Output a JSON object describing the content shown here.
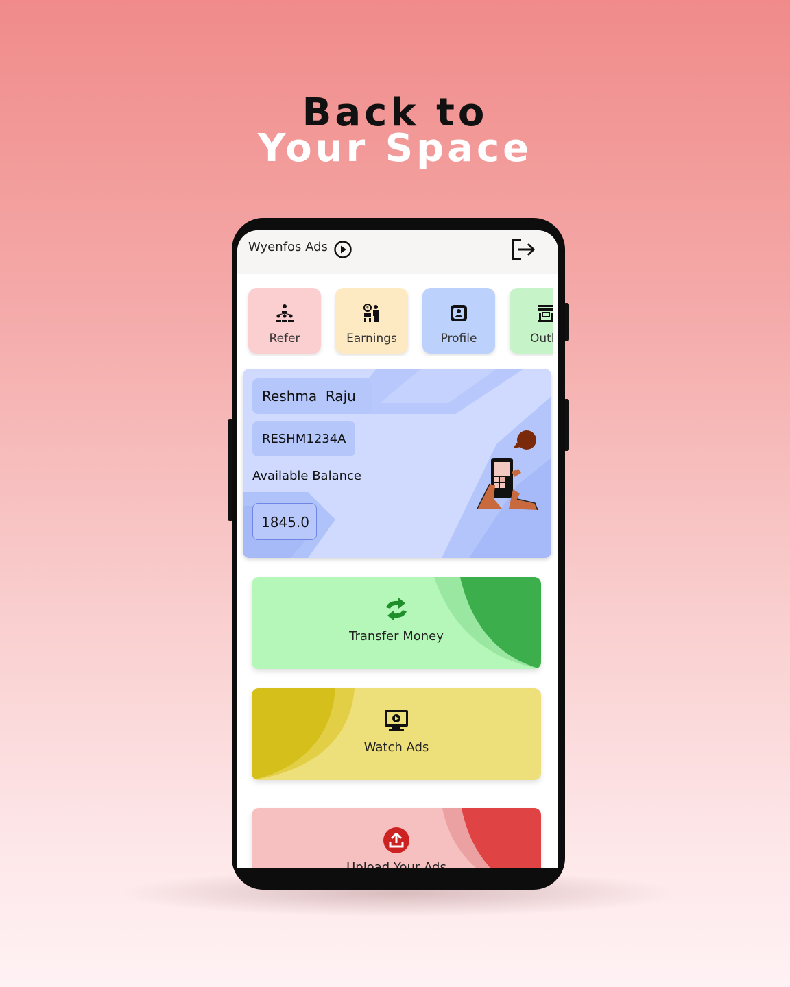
{
  "headline": {
    "line1": "Back to",
    "line2": "Your Space"
  },
  "app": {
    "title": "Wyenfos Ads",
    "title_icon": "play-circle-icon",
    "logout_icon": "logout-icon"
  },
  "quick_actions": [
    {
      "label": "Refer",
      "icon": "referral-network-icon",
      "color": "#fbcfd0"
    },
    {
      "label": "Earnings",
      "icon": "earnings-icon",
      "color": "#fde9c2"
    },
    {
      "label": "Profile",
      "icon": "profile-icon",
      "color": "#bcd1fb"
    },
    {
      "label": "Outle",
      "icon": "outlet-store-icon",
      "color": "#c7f3c9"
    }
  ],
  "balance_card": {
    "name": "Reshma  Raju",
    "user_id": "RESHM1234A",
    "balance_label": "Available Balance",
    "balance": "1845.0",
    "illustration": "phone-in-hand-illustration"
  },
  "actions": [
    {
      "label": "Transfer Money",
      "icon": "transfer-arrows-icon",
      "color": "#b5f7b9",
      "accent": "#3cae4c"
    },
    {
      "label": "Watch Ads",
      "icon": "monitor-play-icon",
      "color": "#ede07a",
      "accent": "#d4bf1b"
    },
    {
      "label": "Upload Your Ads",
      "icon": "upload-icon",
      "color": "#f6bfc0",
      "accent": "#e04343"
    }
  ]
}
